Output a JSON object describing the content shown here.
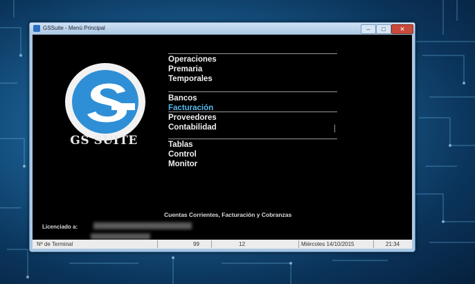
{
  "window": {
    "title": "GSSuite - Menú Principal",
    "buttons": {
      "minimize": "–",
      "maximize": "□",
      "close": "✕"
    }
  },
  "logo": {
    "brand_name": "GS SUITE",
    "icon": "gs-logo-icon",
    "colors": {
      "ring": "#e6e6e6",
      "accent": "#2f8fd6"
    }
  },
  "menu": {
    "groups": [
      {
        "items": [
          {
            "label": "Operaciones"
          },
          {
            "label": "Premaria"
          },
          {
            "label": "Temporales"
          }
        ]
      },
      {
        "items": [
          {
            "label": "Bancos"
          },
          {
            "label": "Facturación",
            "selected": true
          },
          {
            "label": "Proveedores"
          },
          {
            "label": "Contabilidad"
          }
        ]
      },
      {
        "items": [
          {
            "label": "Tablas"
          },
          {
            "label": "Control"
          },
          {
            "label": "Monitor"
          }
        ]
      }
    ],
    "selected_color": "#56b8ee"
  },
  "subtitle": "Cuentas Corrientes, Facturación y Cobranzas",
  "license": {
    "label": "Licenciado a:"
  },
  "statusbar": {
    "left": "Nº de Terminal",
    "mid1": "99",
    "mid2": "12",
    "date": "Miércoles 14/10/2015",
    "time": "21:34"
  }
}
